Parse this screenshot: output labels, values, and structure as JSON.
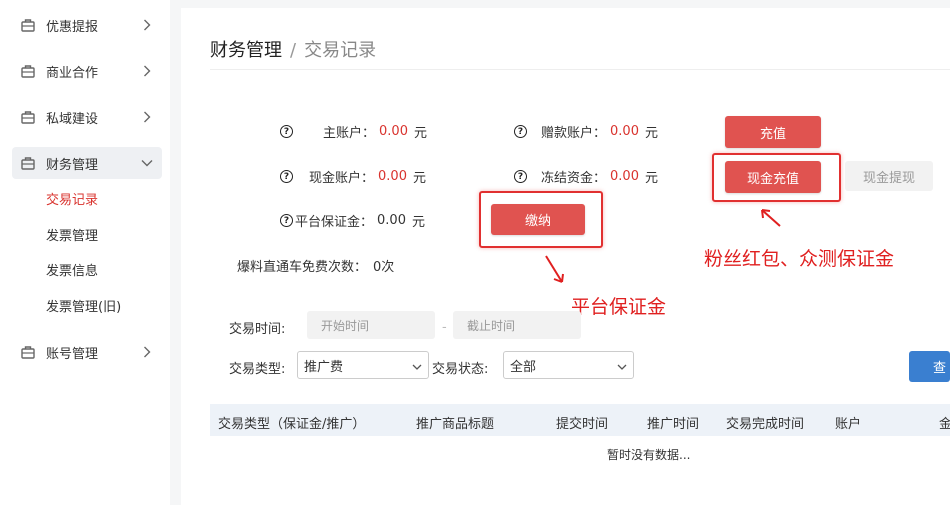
{
  "sidebar": {
    "items": [
      {
        "label": "优惠提报",
        "icon": "briefcase-icon"
      },
      {
        "label": "商业合作",
        "icon": "briefcase-icon"
      },
      {
        "label": "私域建设",
        "icon": "briefcase-icon"
      },
      {
        "label": "财务管理",
        "icon": "briefcase-icon"
      },
      {
        "label": "账号管理",
        "icon": "briefcase-icon"
      }
    ],
    "finance_sub": [
      "交易记录",
      "发票管理",
      "发票信息",
      "发票管理(旧)"
    ]
  },
  "breadcrumb": {
    "parent": "财务管理",
    "separator": "/",
    "current": "交易记录"
  },
  "account": {
    "main_label": "主账户：",
    "main_value": "0.00",
    "main_unit": "元",
    "gift_label": "赠款账户：",
    "gift_value": "0.00",
    "gift_unit": "元",
    "cash_label": "现金账户：",
    "cash_value": "0.00",
    "cash_unit": "元",
    "frozen_label": "冻结资金：",
    "frozen_value": "0.00",
    "frozen_unit": "元",
    "deposit_label": "平台保证金：",
    "deposit_value": "0.00",
    "deposit_unit": "元",
    "free_label": "爆料直通车免费次数：",
    "free_value": "0次"
  },
  "buttons": {
    "recharge": "充值",
    "cash_recharge": "现金充值",
    "cash_withdraw": "现金提现",
    "pay": "缴纳",
    "query": "查"
  },
  "annotations": {
    "right": "粉丝红包、众测保证金",
    "bottom": "平台保证金"
  },
  "filters": {
    "time_label": "交易时间:",
    "start_placeholder": "开始时间",
    "dash": "-",
    "end_placeholder": "截止时间",
    "type_label": "交易类型:",
    "type_value": "推广费",
    "status_label": "交易状态:",
    "status_value": "全部"
  },
  "table": {
    "headers": [
      "交易类型（保证金/推广）",
      "推广商品标题",
      "提交时间",
      "推广时间",
      "交易完成时间",
      "账户",
      "金"
    ],
    "empty": "暂时没有数据..."
  },
  "colors": {
    "accent_red": "#e05350",
    "value_red": "#d9332e",
    "annotation_red": "#e02020",
    "blue": "#3a7fd0"
  }
}
